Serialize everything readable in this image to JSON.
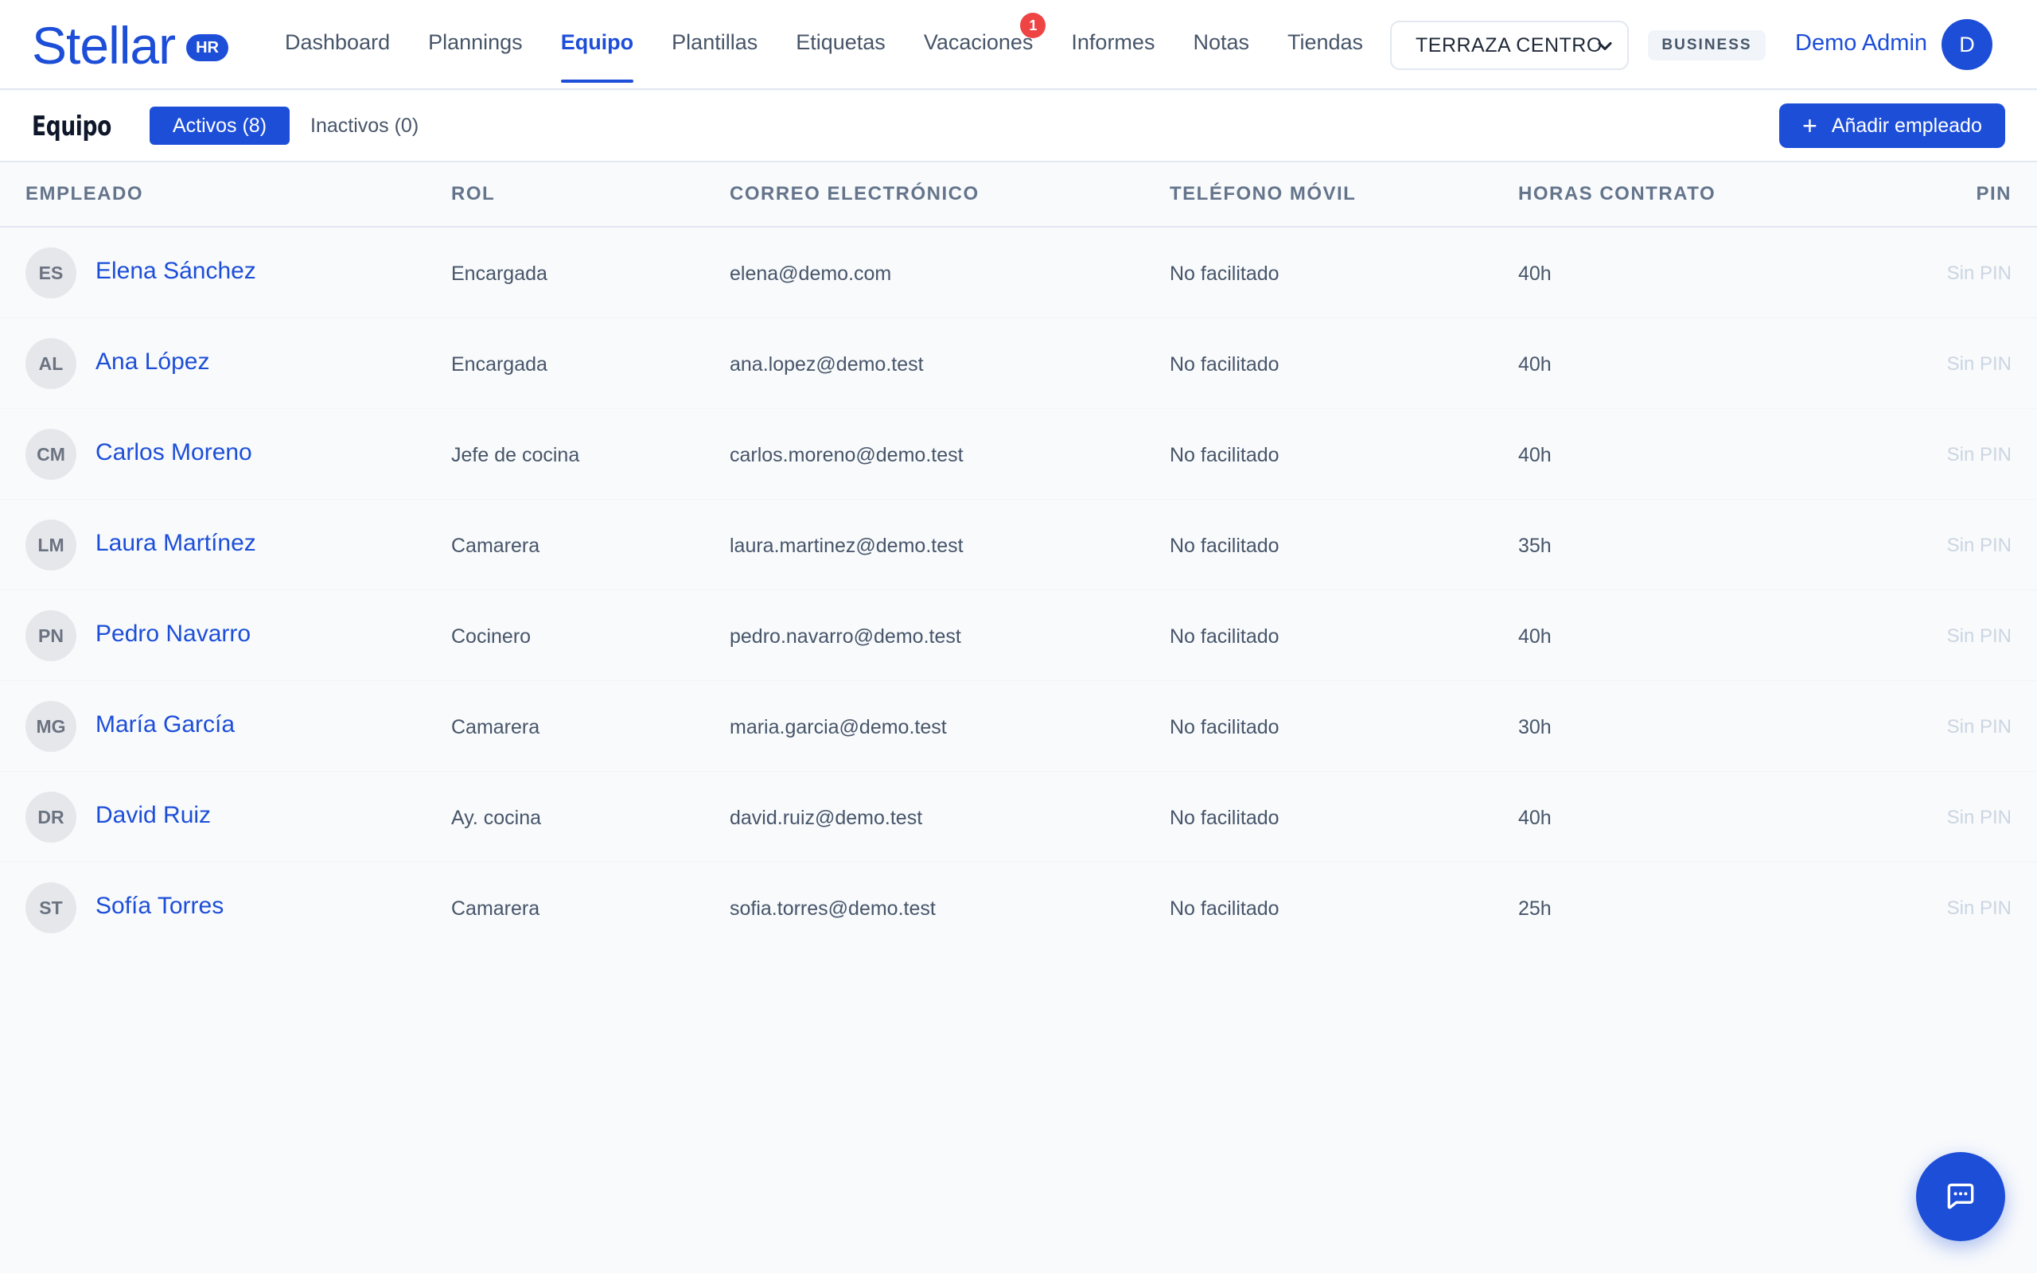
{
  "app": {
    "logo_text": "Stellar",
    "logo_badge": "HR",
    "brand_color": "#1d4ed8"
  },
  "nav": {
    "items": [
      {
        "label": "Dashboard",
        "active": false
      },
      {
        "label": "Plannings",
        "active": false
      },
      {
        "label": "Equipo",
        "active": true
      },
      {
        "label": "Plantillas",
        "active": false
      },
      {
        "label": "Etiquetas",
        "active": false
      },
      {
        "label": "Vacaciones",
        "active": false,
        "badge": "1"
      },
      {
        "label": "Informes",
        "active": false
      },
      {
        "label": "Notas",
        "active": false
      },
      {
        "label": "Tiendas",
        "active": false
      }
    ],
    "store_select_value": "TERRAZA CENTRO",
    "plan_badge": "BUSINESS",
    "user_name": "Demo Admin",
    "user_initial": "D"
  },
  "subheader": {
    "title": "Equipo",
    "tab_active_label": "Activos (8)",
    "tab_inactive_label": "Inactivos (0)",
    "add_button_label": "Añadir empleado"
  },
  "table": {
    "headers": {
      "employee": "EMPLEADO",
      "role": "ROL",
      "email": "CORREO ELECTRÓNICO",
      "phone": "TELÉFONO MÓVIL",
      "hours": "HORAS CONTRATO",
      "pin": "PIN"
    },
    "rows": [
      {
        "initials": "ES",
        "name": "Elena Sánchez",
        "role": "Encargada",
        "email": "elena@demo.com",
        "phone": "No facilitado",
        "hours": "40h",
        "pin": "Sin PIN"
      },
      {
        "initials": "AL",
        "name": "Ana López",
        "role": "Encargada",
        "email": "ana.lopez@demo.test",
        "phone": "No facilitado",
        "hours": "40h",
        "pin": "Sin PIN"
      },
      {
        "initials": "CM",
        "name": "Carlos Moreno",
        "role": "Jefe de cocina",
        "email": "carlos.moreno@demo.test",
        "phone": "No facilitado",
        "hours": "40h",
        "pin": "Sin PIN"
      },
      {
        "initials": "LM",
        "name": "Laura Martínez",
        "role": "Camarera",
        "email": "laura.martinez@demo.test",
        "phone": "No facilitado",
        "hours": "35h",
        "pin": "Sin PIN"
      },
      {
        "initials": "PN",
        "name": "Pedro Navarro",
        "role": "Cocinero",
        "email": "pedro.navarro@demo.test",
        "phone": "No facilitado",
        "hours": "40h",
        "pin": "Sin PIN"
      },
      {
        "initials": "MG",
        "name": "María García",
        "role": "Camarera",
        "email": "maria.garcia@demo.test",
        "phone": "No facilitado",
        "hours": "30h",
        "pin": "Sin PIN"
      },
      {
        "initials": "DR",
        "name": "David Ruiz",
        "role": "Ay. cocina",
        "email": "david.ruiz@demo.test",
        "phone": "No facilitado",
        "hours": "40h",
        "pin": "Sin PIN"
      },
      {
        "initials": "ST",
        "name": "Sofía Torres",
        "role": "Camarera",
        "email": "sofia.torres@demo.test",
        "phone": "No facilitado",
        "hours": "25h",
        "pin": "Sin PIN"
      }
    ]
  },
  "icons": {
    "chat_fab": "chat-bubble-icon",
    "add": "plus-icon",
    "select": "chevron-down-icon"
  }
}
